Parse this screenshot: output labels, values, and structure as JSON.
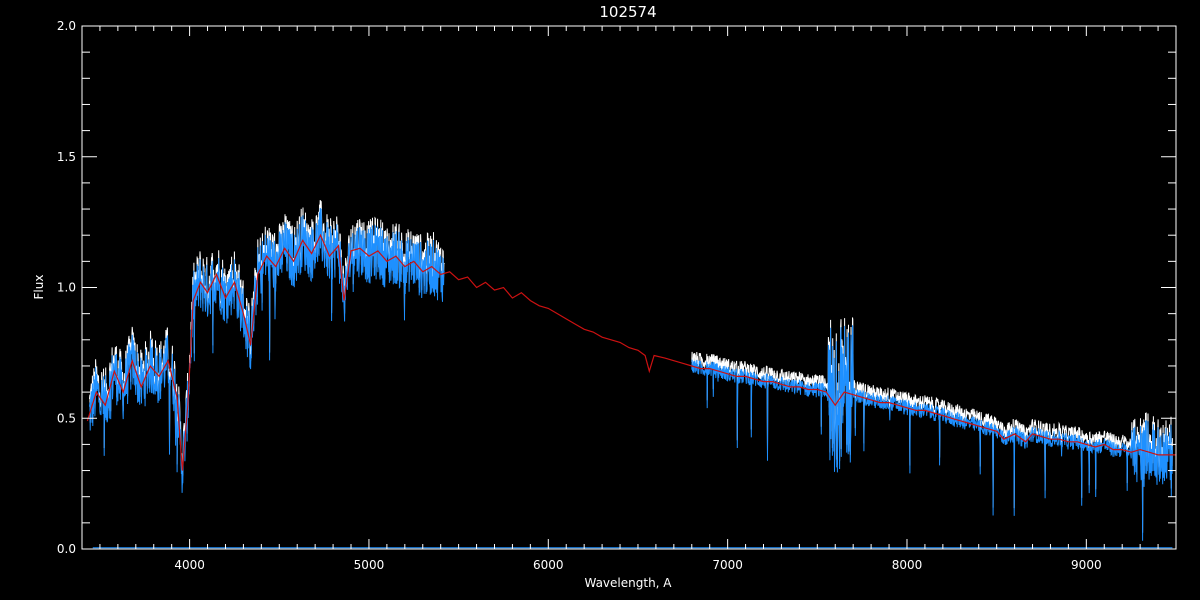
{
  "chart_data": {
    "type": "line",
    "title": "102574",
    "xlabel": "Wavelength, A",
    "ylabel": "Flux",
    "xlim": [
      3400,
      9500
    ],
    "ylim": [
      0.0,
      2.0
    ],
    "x_ticks": [
      4000,
      5000,
      6000,
      7000,
      8000,
      9000
    ],
    "y_ticks": [
      0.0,
      0.5,
      1.0,
      1.5,
      2.0
    ],
    "grid": false,
    "legend": "none",
    "colors": {
      "background": "#000000",
      "axes": "#ffffff",
      "observed": "#1e90ff",
      "model": "#cc1111",
      "observed_upper": "#ffffff"
    },
    "series": [
      {
        "color": "#cc1111",
        "style": "line",
        "x": [
          3430,
          3480,
          3530,
          3580,
          3630,
          3680,
          3730,
          3780,
          3830,
          3880,
          3930,
          3960,
          3990,
          4020,
          4060,
          4100,
          4150,
          4200,
          4250,
          4300,
          4340,
          4380,
          4430,
          4480,
          4530,
          4580,
          4630,
          4680,
          4730,
          4780,
          4830,
          4861,
          4900,
          4950,
          5000,
          5050,
          5100,
          5150,
          5200,
          5250,
          5300,
          5350,
          5400,
          5450,
          5500,
          5550,
          5600,
          5650,
          5700,
          5750,
          5800,
          5850,
          5900,
          5950,
          6000,
          6050,
          6100,
          6150,
          6200,
          6250,
          6300,
          6350,
          6400,
          6450,
          6500,
          6540,
          6563,
          6590,
          6650,
          6700,
          6750,
          6800,
          6850,
          6900,
          6950,
          7000,
          7050,
          7100,
          7150,
          7200,
          7250,
          7300,
          7350,
          7400,
          7450,
          7500,
          7550,
          7600,
          7650,
          7700,
          7750,
          7800,
          7850,
          7900,
          7950,
          8000,
          8050,
          8100,
          8150,
          8200,
          8250,
          8300,
          8350,
          8400,
          8450,
          8500,
          8540,
          8600,
          8662,
          8700,
          8750,
          8800,
          8850,
          8900,
          8950,
          9000,
          9050,
          9100,
          9150,
          9200,
          9250,
          9300,
          9350,
          9400,
          9450,
          9500
        ],
        "y": [
          0.49,
          0.6,
          0.55,
          0.68,
          0.6,
          0.72,
          0.62,
          0.7,
          0.66,
          0.72,
          0.58,
          0.3,
          0.55,
          0.95,
          1.02,
          0.98,
          1.05,
          0.96,
          1.02,
          0.9,
          0.78,
          1.05,
          1.12,
          1.08,
          1.15,
          1.1,
          1.18,
          1.13,
          1.2,
          1.12,
          1.16,
          0.95,
          1.14,
          1.15,
          1.12,
          1.14,
          1.1,
          1.12,
          1.08,
          1.1,
          1.06,
          1.08,
          1.05,
          1.06,
          1.03,
          1.04,
          1.0,
          1.02,
          0.99,
          1.0,
          0.96,
          0.98,
          0.95,
          0.93,
          0.92,
          0.9,
          0.88,
          0.86,
          0.84,
          0.83,
          0.81,
          0.8,
          0.79,
          0.77,
          0.76,
          0.74,
          0.68,
          0.74,
          0.73,
          0.72,
          0.71,
          0.7,
          0.69,
          0.69,
          0.68,
          0.67,
          0.66,
          0.66,
          0.65,
          0.64,
          0.64,
          0.63,
          0.62,
          0.62,
          0.61,
          0.61,
          0.6,
          0.55,
          0.6,
          0.59,
          0.58,
          0.57,
          0.56,
          0.56,
          0.55,
          0.54,
          0.53,
          0.53,
          0.52,
          0.51,
          0.5,
          0.49,
          0.48,
          0.47,
          0.46,
          0.45,
          0.42,
          0.44,
          0.41,
          0.44,
          0.43,
          0.42,
          0.42,
          0.41,
          0.41,
          0.4,
          0.39,
          0.4,
          0.38,
          0.38,
          0.37,
          0.38,
          0.37,
          0.36,
          0.36,
          0.36
        ]
      }
    ]
  }
}
